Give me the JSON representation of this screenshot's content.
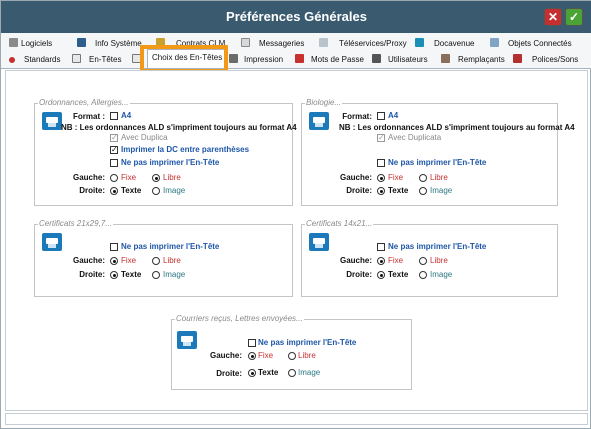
{
  "window": {
    "title": "Préférences Générales"
  },
  "colors": {
    "titlebar": "#3a5a70",
    "close_button": "#c62f2f",
    "ok_button": "#4aa334",
    "highlight": "#f29a18",
    "label_blue": "#1f57a8",
    "fixe_red": "#c8312e",
    "image_teal": "#2d7a82"
  },
  "tabs_row1": [
    {
      "label": "Logiciels",
      "icon": "cart-icon"
    },
    {
      "label": "Info Système",
      "icon": "monitor-icon"
    },
    {
      "label": "Contrats CLM",
      "icon": "pen-icon"
    },
    {
      "label": "Messageries",
      "icon": "envelope-icon"
    },
    {
      "label": "Téléservices/Proxy",
      "icon": "network-icon"
    },
    {
      "label": "Docavenue",
      "icon": "docavenue-icon"
    },
    {
      "label": "Objets Connectés",
      "icon": "wireless-icon"
    }
  ],
  "tabs_row2": [
    {
      "label": "Standards",
      "icon": "dot-icon"
    },
    {
      "label": "En-Têtes",
      "icon": "document-icon"
    },
    {
      "label": "Choix des En-Têtes",
      "icon": "",
      "active": true
    },
    {
      "label": "Impression",
      "icon": "printer-icon"
    },
    {
      "label": "Mots de Passe",
      "icon": "key-icon"
    },
    {
      "label": "Utilisateurs",
      "icon": "user-icon"
    },
    {
      "label": "Remplaçants",
      "icon": "users-icon"
    },
    {
      "label": "Polices/Sons",
      "icon": "font-icon"
    }
  ],
  "groups": {
    "ordonnances": {
      "title": "Ordonnances, Allergies...",
      "format_label": "Format :",
      "format_value": "A4",
      "nb_note": "NB : Les ordonnances ALD s'impriment toujours au format A4",
      "duplicata": "Avec Duplica",
      "dc_parentheses": "Imprimer la DC entre parenthèses",
      "no_header": "Ne pas imprimer l'En-Tête",
      "gauche_label": "Gauche:",
      "droite_label": "Droite:",
      "fixe": "Fixe",
      "libre": "Libre",
      "texte": "Texte",
      "image": "Image"
    },
    "biologie": {
      "title": "Biologie...",
      "format_label": "Format:",
      "format_value": "A4",
      "nb_note": "NB : Les ordonnances ALD s'impriment toujours au format A4",
      "duplicata": "Avec Duplicata",
      "no_header": "Ne pas imprimer l'En-Tête",
      "gauche_label": "Gauche:",
      "droite_label": "Droite:",
      "fixe": "Fixe",
      "libre": "Libre",
      "texte": "Texte",
      "image": "Image"
    },
    "certificats_a4": {
      "title": "Certificats 21x29,7...",
      "no_header": "Ne pas imprimer l'En-Tête",
      "gauche_label": "Gauche:",
      "droite_label": "Droite:",
      "fixe": "Fixe",
      "libre": "Libre",
      "texte": "Texte",
      "image": "Image"
    },
    "certificats_small": {
      "title": "Certificats 14x21...",
      "no_header": "Ne pas imprimer l'En-Tête",
      "gauche_label": "Gauche:",
      "droite_label": "Droite:",
      "fixe": "Fixe",
      "libre": "Libre",
      "texte": "Texte",
      "image": "Image"
    },
    "courriers": {
      "title": "Courriers reçus, Lettres envoyées...",
      "no_header": "Ne pas imprimer l'En-Tête",
      "gauche_label": "Gauche:",
      "droite_label": "Droite:",
      "fixe": "Fixe",
      "libre": "Libre",
      "texte": "Texte",
      "image": "Image"
    }
  }
}
